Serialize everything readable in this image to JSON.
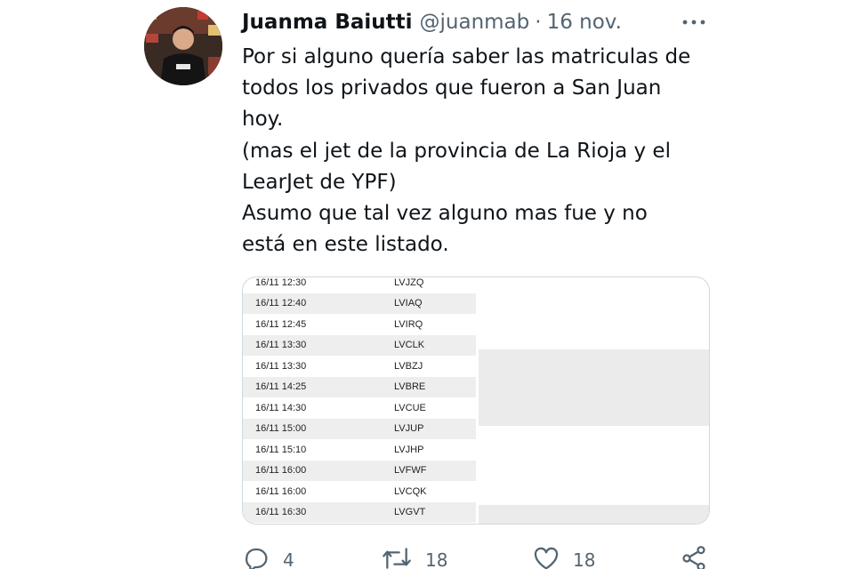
{
  "tweet": {
    "author_name": "Juanma Baiutti",
    "handle": "@juanmab",
    "separator": "·",
    "time": "16 nov.",
    "text": "Por si alguno quería saber las matriculas de\ntodos los privados que fueron a San Juan\nhoy.\n(mas el jet de la provincia de La Rioja y el\nLearJet de YPF)\nAsumo que tal vez alguno mas fue y no\nestá en este listado."
  },
  "media_table": {
    "rows": [
      {
        "time": "16/11 12:30",
        "plate": "LVJZQ"
      },
      {
        "time": "16/11 12:40",
        "plate": "LVIAQ"
      },
      {
        "time": "16/11 12:45",
        "plate": "LVIRQ"
      },
      {
        "time": "16/11 13:30",
        "plate": "LVCLK"
      },
      {
        "time": "16/11 13:30",
        "plate": "LVBZJ"
      },
      {
        "time": "16/11 14:25",
        "plate": "LVBRE"
      },
      {
        "time": "16/11 14:30",
        "plate": "LVCUE"
      },
      {
        "time": "16/11 15:00",
        "plate": "LVJUP"
      },
      {
        "time": "16/11 15:10",
        "plate": "LVJHP"
      },
      {
        "time": "16/11 16:00",
        "plate": "LVFWF"
      },
      {
        "time": "16/11 16:00",
        "plate": "LVCQK"
      },
      {
        "time": "16/11 16:30",
        "plate": "LVGVT"
      }
    ]
  },
  "actions": {
    "replies": "4",
    "retweets": "18",
    "likes": "18"
  },
  "icons": {
    "more": "more-icon",
    "reply": "reply-icon",
    "retweet": "retweet-icon",
    "like": "heart-icon",
    "share": "share-icon"
  },
  "colors": {
    "text": "#0f1419",
    "secondary": "#536471",
    "border": "#cfd9de",
    "row_shade": "#eeeeee"
  }
}
